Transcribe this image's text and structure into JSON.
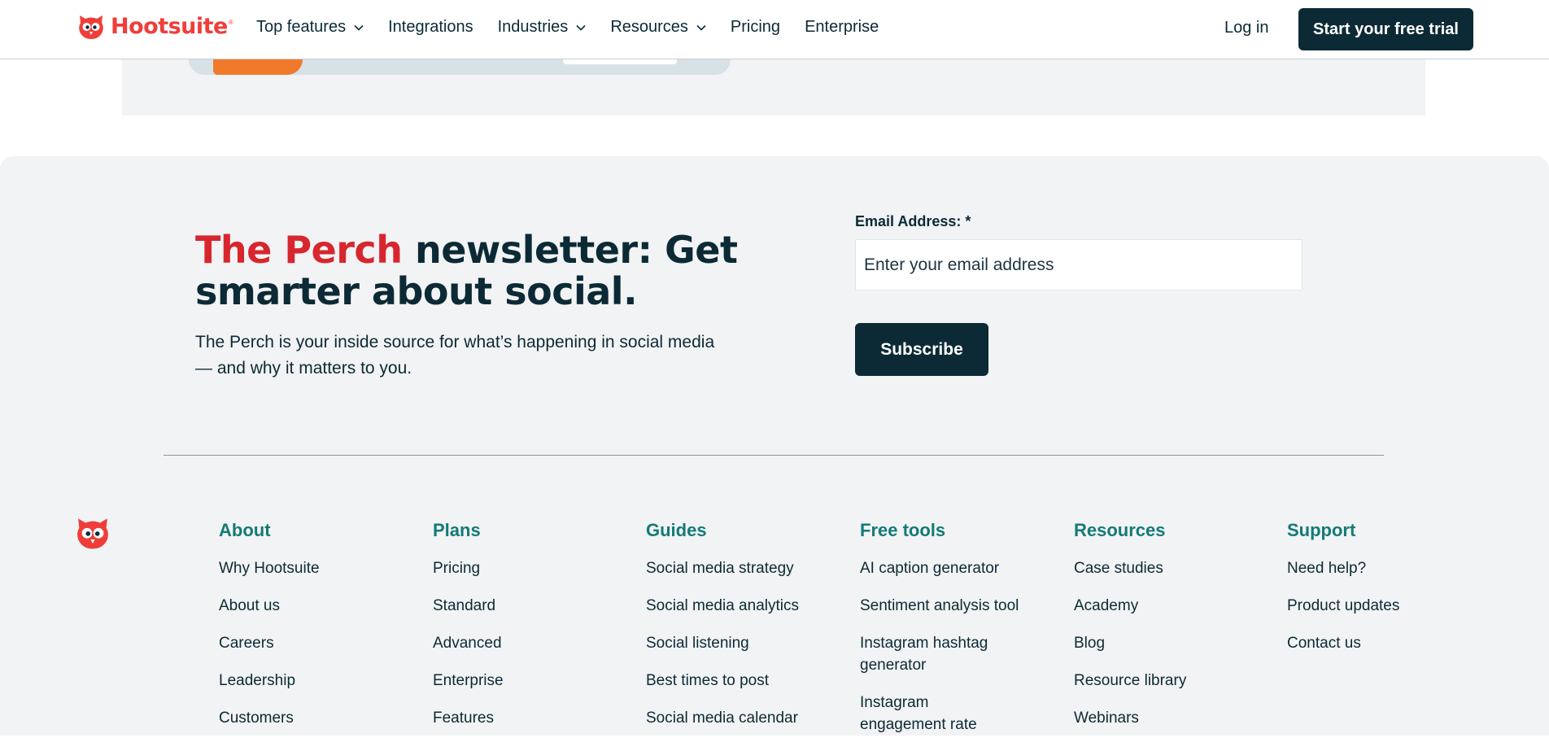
{
  "header": {
    "logo_text": "Hootsuite",
    "logo_tm": "®",
    "nav": [
      {
        "label": "Top features",
        "has_dropdown": true
      },
      {
        "label": "Integrations",
        "has_dropdown": false
      },
      {
        "label": "Industries",
        "has_dropdown": true
      },
      {
        "label": "Resources",
        "has_dropdown": true
      },
      {
        "label": "Pricing",
        "has_dropdown": false
      },
      {
        "label": "Enterprise",
        "has_dropdown": false
      }
    ],
    "login": "Log in",
    "cta": "Start your free trial"
  },
  "newsletter": {
    "title_accent": "The Perch",
    "title_rest": " newsletter: Get smarter about social.",
    "description": "The Perch is your inside source for what’s happening in social media — and why it matters to you.",
    "email_label": "Email Address: *",
    "email_placeholder": "Enter your email address",
    "subscribe": "Subscribe"
  },
  "footer": {
    "columns": [
      {
        "heading": "About",
        "links": [
          "Why Hootsuite",
          "About us",
          "Careers",
          "Leadership",
          "Customers"
        ]
      },
      {
        "heading": "Plans",
        "links": [
          "Pricing",
          "Standard",
          "Advanced",
          "Enterprise",
          "Features"
        ]
      },
      {
        "heading": "Guides",
        "links": [
          "Social media strategy",
          "Social media analytics",
          "Social listening",
          "Best times to post",
          "Social media calendar"
        ]
      },
      {
        "heading": "Free tools",
        "links": [
          "AI caption generator",
          "Sentiment analysis tool",
          "Instagram hashtag generator",
          "Instagram engagement rate"
        ]
      },
      {
        "heading": "Resources",
        "links": [
          "Case studies",
          "Academy",
          "Blog",
          "Resource library",
          "Webinars"
        ]
      },
      {
        "heading": "Support",
        "links": [
          "Need help?",
          "Product updates",
          "Contact us"
        ]
      }
    ]
  },
  "colors": {
    "brand_red": "#ef3e3a",
    "dark_navy": "#0c2a35",
    "teal_heading": "#137a77",
    "section_bg": "#f2f3f4"
  },
  "icons": [
    "hootsuite-owl-logo-icon",
    "chevron-down-icon",
    "footer-owl-icon"
  ]
}
